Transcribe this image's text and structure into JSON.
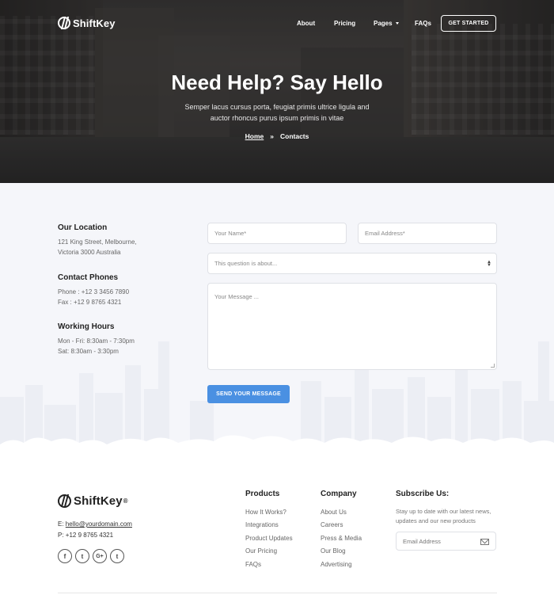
{
  "nav": {
    "brand": "ShiftKey",
    "links": [
      {
        "label": "About"
      },
      {
        "label": "Pricing"
      },
      {
        "label": "Pages"
      },
      {
        "label": "FAQs"
      }
    ],
    "cta": "GET STARTED"
  },
  "hero": {
    "title": "Need Help? Say Hello",
    "subtitle": "Semper lacus cursus porta, feugiat primis ultrice ligula and auctor rhoncus purus ipsum primis in vitae",
    "breadcrumb": {
      "home": "Home",
      "separator": "»",
      "current": "Contacts"
    }
  },
  "contact_info": {
    "location": {
      "title": "Our Location",
      "line1": "121 King Street, Melbourne,",
      "line2": "Victoria 3000 Australia"
    },
    "phones": {
      "title": "Contact Phones",
      "line1": "Phone : +12 3 3456 7890",
      "line2": "Fax : +12 9 8765 4321"
    },
    "hours": {
      "title": "Working Hours",
      "line1": "Mon - Fri: 8:30am - 7:30pm",
      "line2": "Sat: 8:30am - 3:30pm"
    }
  },
  "form": {
    "name_placeholder": "Your Name*",
    "email_placeholder": "Email Address*",
    "subject_placeholder": "This question is about...",
    "message_placeholder": "Your Message ...",
    "submit": "SEND YOUR MESSAGE"
  },
  "footer": {
    "brand": "ShiftKey",
    "registered": "®",
    "email_label": "E:",
    "email": "hello@yourdomain.com",
    "phone_label": "P:",
    "phone": "+12 9 8765 4321",
    "social": [
      {
        "icon": "facebook-icon",
        "glyph": "f"
      },
      {
        "icon": "twitter-icon",
        "glyph": "t"
      },
      {
        "icon": "google-plus-icon",
        "glyph": "G+"
      },
      {
        "icon": "tumblr-icon",
        "glyph": "t"
      }
    ],
    "products": {
      "title": "Products",
      "links": [
        "How It Works?",
        "Integrations",
        "Product Updates",
        "Our Pricing",
        "FAQs"
      ]
    },
    "company": {
      "title": "Company",
      "links": [
        "About Us",
        "Careers",
        "Press & Media",
        "Our Blog",
        "Advertising"
      ]
    },
    "subscribe": {
      "title": "Subscribe Us:",
      "text": "Stay up to date with our latest news, updates and our new products",
      "placeholder": "Email Address"
    }
  },
  "colors": {
    "accent": "#4a90e2",
    "section_bg": "#f5f6fa"
  }
}
